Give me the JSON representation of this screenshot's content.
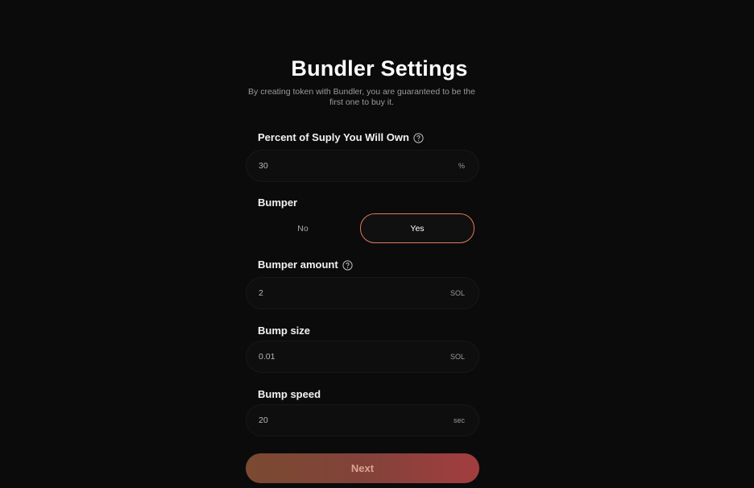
{
  "header": {
    "title": "Bundler Settings",
    "subtitle": "By creating token with Bundler, you are guaranteed to be the first one to buy it."
  },
  "fields": {
    "supply_percent": {
      "label": "Percent of Suply You Will Own",
      "value": "30",
      "unit": "%",
      "icon": "help-icon"
    },
    "bumper": {
      "label": "Bumper",
      "options": [
        "No",
        "Yes"
      ],
      "selected": "Yes"
    },
    "bumper_amount": {
      "label": "Bumper amount",
      "value": "2",
      "unit": "SOL",
      "icon": "help-icon"
    },
    "bump_size": {
      "label": "Bump size",
      "value": "0.01",
      "unit": "SOL"
    },
    "bump_speed": {
      "label": "Bump speed",
      "value": "20",
      "unit": "sec"
    }
  },
  "actions": {
    "next_label": "Next"
  },
  "colors": {
    "background": "#0b0b0b",
    "accent": "#e0795a",
    "button_gradient_start": "#7a4a31",
    "button_gradient_end": "#a33d3f"
  }
}
